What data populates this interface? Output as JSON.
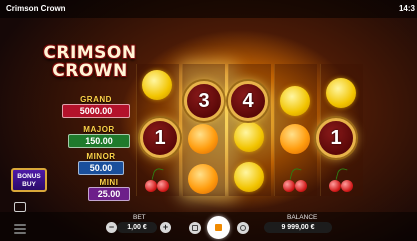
{
  "topbar": {
    "title": "Crimson Crown",
    "clock": "14:3"
  },
  "logo": {
    "line1": "CRIMSON",
    "line2": "CROWN"
  },
  "jackpots": {
    "grand": {
      "label": "GRAND",
      "value": "5000.00"
    },
    "major": {
      "label": "MAJOR",
      "value": "150.00"
    },
    "minor": {
      "label": "MINOR",
      "value": "50.00"
    },
    "mini": {
      "label": "MINI",
      "value": "25.00"
    }
  },
  "bonus_buy": {
    "line1": "BONUS",
    "line2": "BUY"
  },
  "reels": {
    "coins": [
      "3",
      "4",
      "1",
      "1"
    ],
    "symbols": [
      "lemon",
      "orange",
      "cherry"
    ]
  },
  "bottom": {
    "bet_label": "BET",
    "bet_value": "1,00 €",
    "balance_label": "BALANCE",
    "balance_value": "9 999,00 €"
  },
  "colors": {
    "grand": "#b3122b",
    "major": "#1f7a2c",
    "minor": "#1a4f9c",
    "mini": "#6d1f8a",
    "accent": "#f08a00"
  }
}
